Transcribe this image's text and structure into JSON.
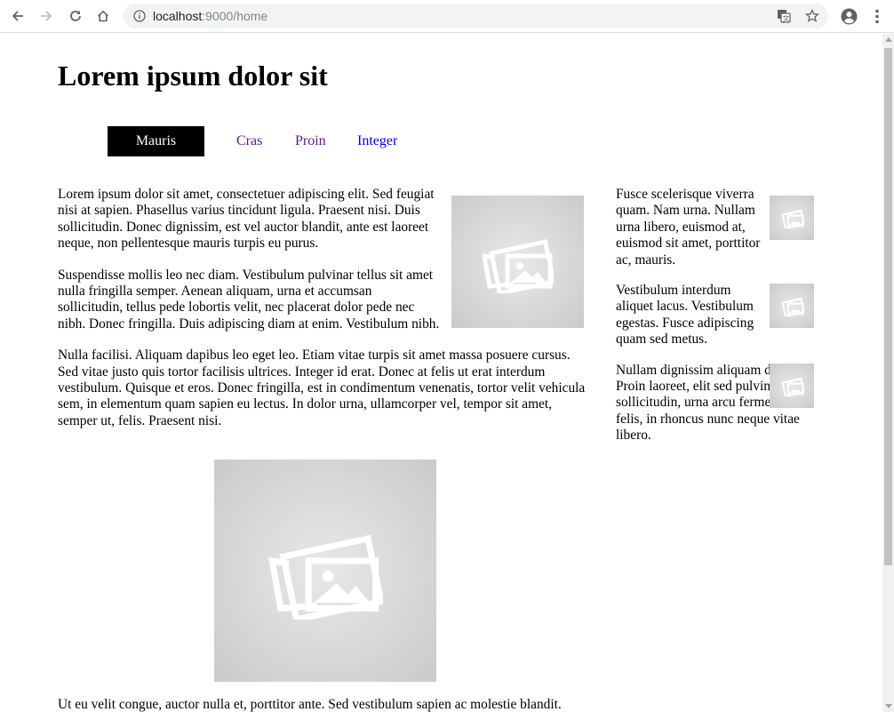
{
  "browser": {
    "url_host": "localhost",
    "url_path": ":9000/home"
  },
  "page": {
    "title": "Lorem ipsum dolor sit",
    "tabs": [
      {
        "label": "Mauris",
        "active": true
      },
      {
        "label": "Cras"
      },
      {
        "label": "Proin"
      },
      {
        "label": "Integer"
      }
    ],
    "main": {
      "paragraphs": [
        "Lorem ipsum dolor sit amet, consectetuer adipiscing elit. Sed feugiat nisi at sapien. Phasellus varius tincidunt ligula. Praesent nisi. Duis sollicitudin. Donec dignissim, est vel auctor blandit, ante est laoreet neque, non pellentesque mauris turpis eu purus.",
        "Suspendisse mollis leo nec diam. Vestibulum pulvinar tellus sit amet nulla fringilla semper. Aenean aliquam, urna et accumsan sollicitudin, tellus pede lobortis velit, nec placerat dolor pede nec nibh. Donec fringilla. Duis adipiscing diam at enim. Vestibulum nibh.",
        "Nulla facilisi. Aliquam dapibus leo eget leo. Etiam vitae turpis sit amet massa posuere cursus. Sed vitae justo quis tortor facilisis ultrices. Integer id erat. Donec at felis ut erat interdum vestibulum. Quisque et eros. Donec fringilla, est in condimentum venenatis, tortor velit vehicula sem, in elementum quam sapien eu lectus. In dolor urna, ullamcorper vel, tempor sit amet, semper ut, felis. Praesent nisi.",
        "Ut eu velit congue, auctor nulla et, porttitor ante. Sed vestibulum sapien ac molestie blandit."
      ]
    },
    "sidebar": {
      "items": [
        {
          "text": "Fusce scelerisque viverra quam. Nam urna. Nullam urna libero, euismod at, euismod sit amet, porttitor ac, mauris."
        },
        {
          "text": "Vestibulum interdum aliquet lacus. Vestibulum egestas. Fusce adipiscing quam sed metus."
        },
        {
          "text": "Nullam dignissim aliquam dui. Proin laoreet, elit sed pulvinar sollicitudin, urna arcu fermentum felis, in rhoncus nunc neque vitae libero."
        }
      ]
    }
  },
  "icons": [
    "back-icon",
    "forward-icon",
    "reload-icon",
    "home-icon",
    "info-icon",
    "translate-icon",
    "star-icon",
    "profile-icon",
    "menu-icon",
    "image-placeholder-icon"
  ]
}
